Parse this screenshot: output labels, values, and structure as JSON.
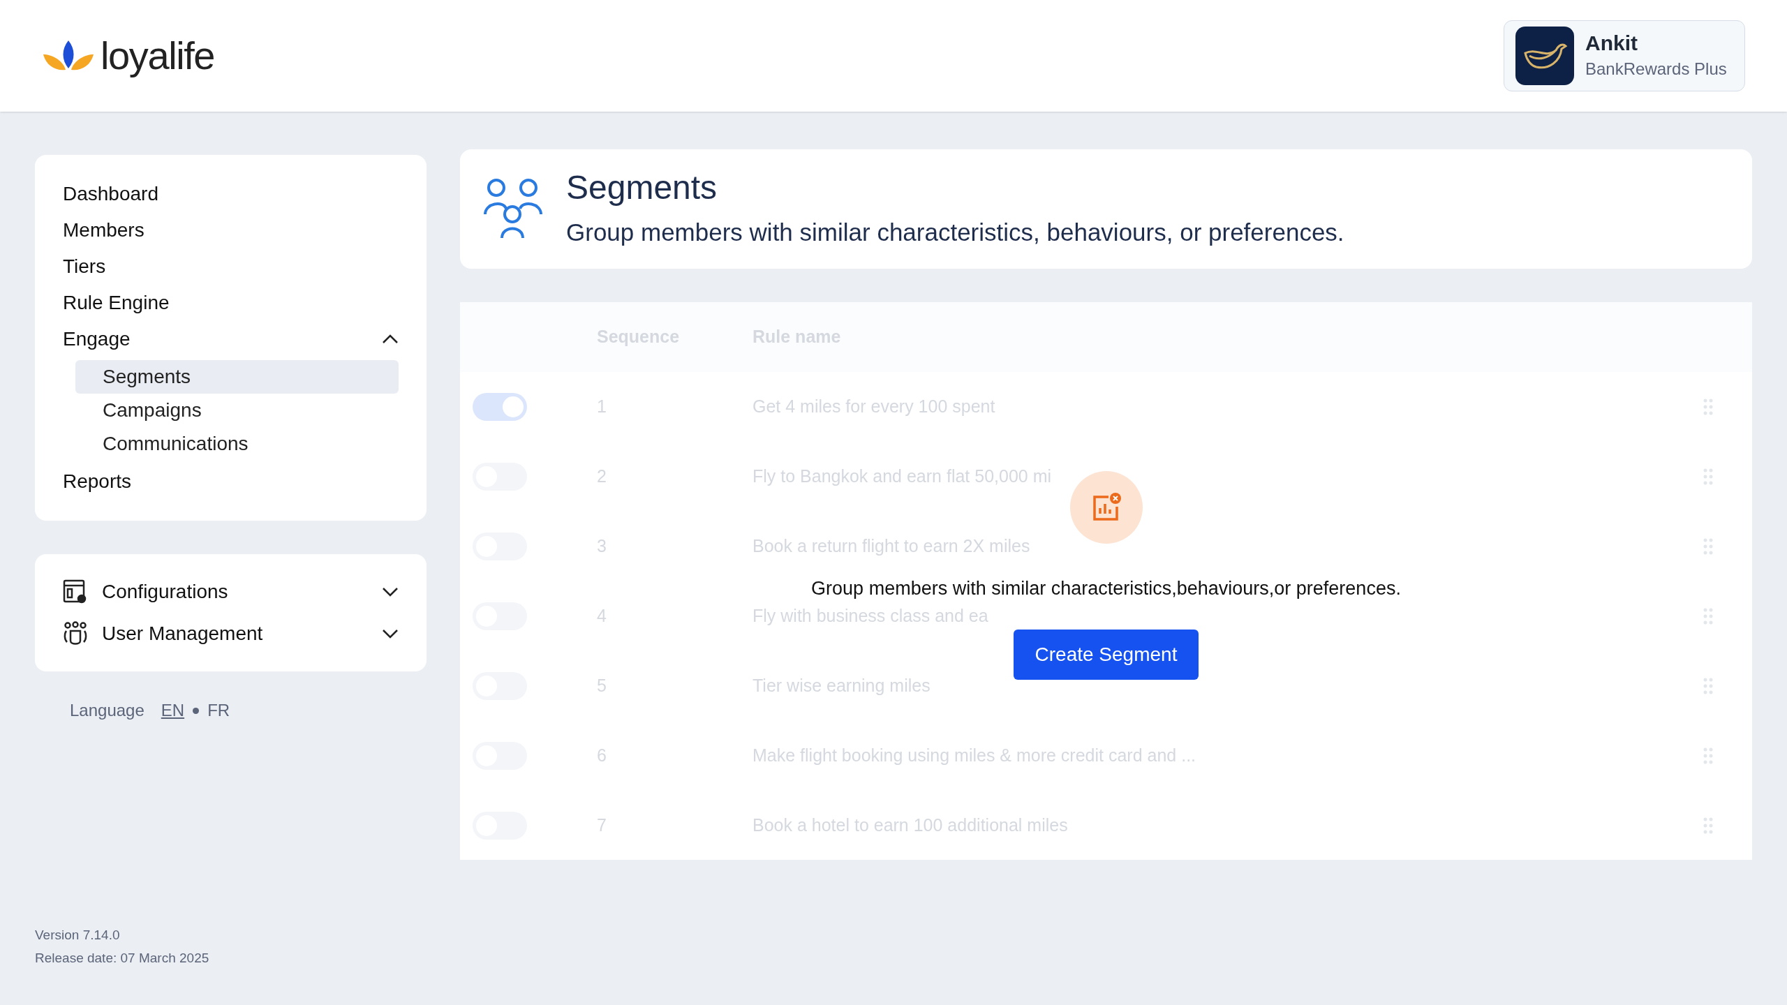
{
  "header": {
    "logo_text": "loyalife",
    "profile": {
      "name": "Ankit",
      "program": "BankRewards Plus"
    }
  },
  "sidebar": {
    "items": [
      {
        "label": "Dashboard",
        "selected": false
      },
      {
        "label": "Members",
        "selected": false
      },
      {
        "label": "Tiers",
        "selected": false
      },
      {
        "label": "Rule Engine",
        "selected": false
      },
      {
        "label": "Engage",
        "selected": false,
        "expanded": true,
        "children": [
          {
            "label": "Segments",
            "selected": true
          },
          {
            "label": "Campaigns",
            "selected": false
          },
          {
            "label": "Communications",
            "selected": false
          }
        ]
      },
      {
        "label": "Reports",
        "selected": false
      }
    ],
    "settings": [
      {
        "label": "Configurations",
        "kind": "config",
        "expanded": false
      },
      {
        "label": "User Management",
        "kind": "users",
        "expanded": false
      }
    ],
    "language": {
      "label": "Language",
      "options": [
        {
          "label": "EN",
          "selected": true
        },
        {
          "label": "FR",
          "selected": false
        }
      ]
    },
    "version": "Version 7.14.0",
    "release_date": "Release date: 07 March 2025"
  },
  "page_header": {
    "title": "Segments",
    "subtitle": "Group members with similar characteristics, behaviours, or preferences."
  },
  "table": {
    "columns": [
      "Sequence",
      "Rule name"
    ],
    "rows": [
      {
        "on": true,
        "sequence": "1",
        "rule_name": "Get 4 miles for every 100 spent"
      },
      {
        "on": false,
        "sequence": "2",
        "rule_name": "Fly to Bangkok and earn flat 50,000 mi"
      },
      {
        "on": false,
        "sequence": "3",
        "rule_name": "Book a return flight to earn 2X miles"
      },
      {
        "on": false,
        "sequence": "4",
        "rule_name": "Fly with business class and ea"
      },
      {
        "on": false,
        "sequence": "5",
        "rule_name": "Tier wise earning miles"
      },
      {
        "on": false,
        "sequence": "6",
        "rule_name": "Make flight booking using miles & more credit card and ..."
      },
      {
        "on": false,
        "sequence": "7",
        "rule_name": "Book a hotel to earn 100 additional miles"
      }
    ]
  },
  "empty_state": {
    "message": "Group members with similar characteristics,behaviours,or preferences.",
    "button": "Create Segment"
  }
}
